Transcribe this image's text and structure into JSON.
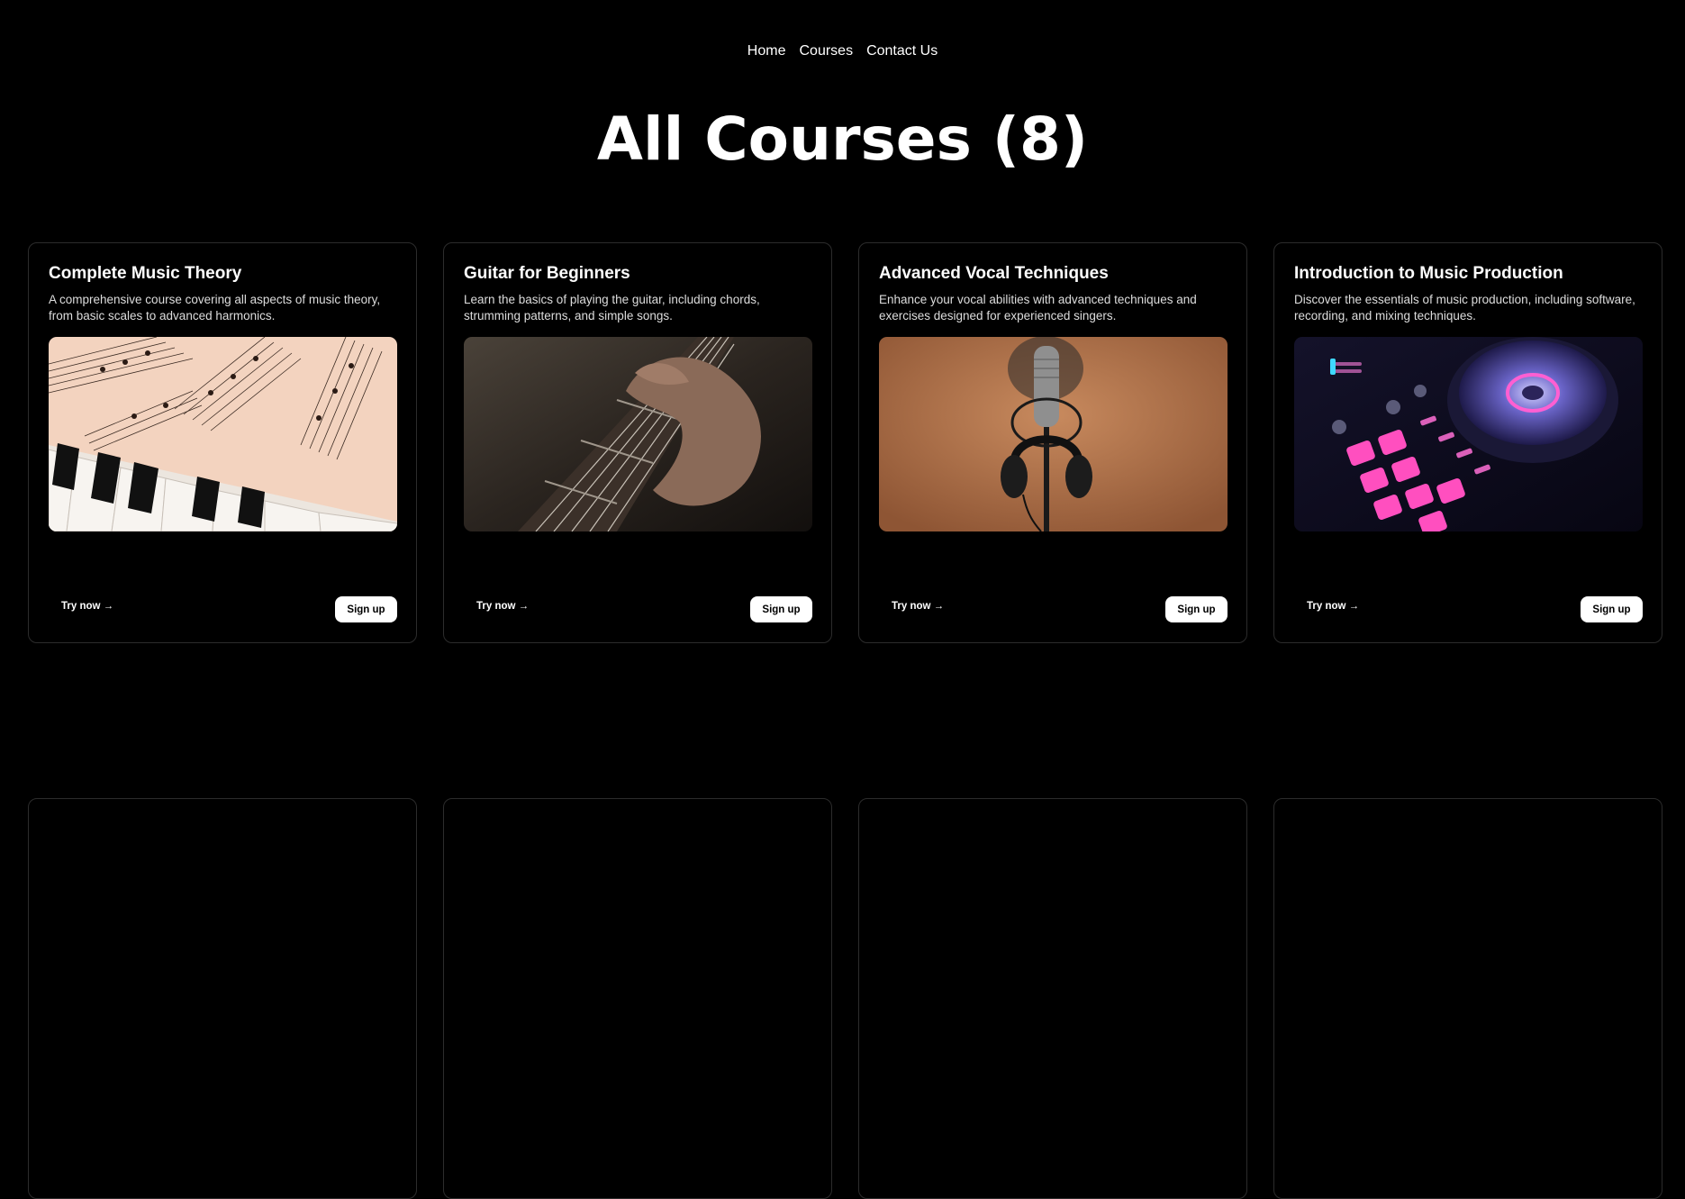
{
  "nav": {
    "items": [
      "Home",
      "Courses",
      "Contact Us"
    ]
  },
  "page": {
    "title": "All Courses (8)"
  },
  "courses": [
    {
      "title": "Complete Music Theory",
      "description": "A comprehensive course covering all aspects of music theory, from basic scales to advanced harmonics.",
      "image": "sheet-music-piano",
      "try_label": "Try now →",
      "signup_label": "Sign up"
    },
    {
      "title": "Guitar for Beginners",
      "description": "Learn the basics of playing the guitar, including chords, strumming patterns, and simple songs.",
      "image": "guitar-fretboard-hand",
      "try_label": "Try now →",
      "signup_label": "Sign up"
    },
    {
      "title": "Advanced Vocal Techniques",
      "description": "Enhance your vocal abilities with advanced techniques and exercises designed for experienced singers.",
      "image": "microphone-headphones",
      "try_label": "Try now →",
      "signup_label": "Sign up"
    },
    {
      "title": "Introduction to Music Production",
      "description": "Discover the essentials of music production, including software, recording, and mixing techniques.",
      "image": "dj-controller",
      "try_label": "Try now →",
      "signup_label": "Sign up"
    }
  ],
  "theme": {
    "background": "#000000",
    "card_border": "#2c2c2c",
    "text": "#ffffff",
    "button_bg": "#ffffff",
    "button_text": "#000000"
  }
}
